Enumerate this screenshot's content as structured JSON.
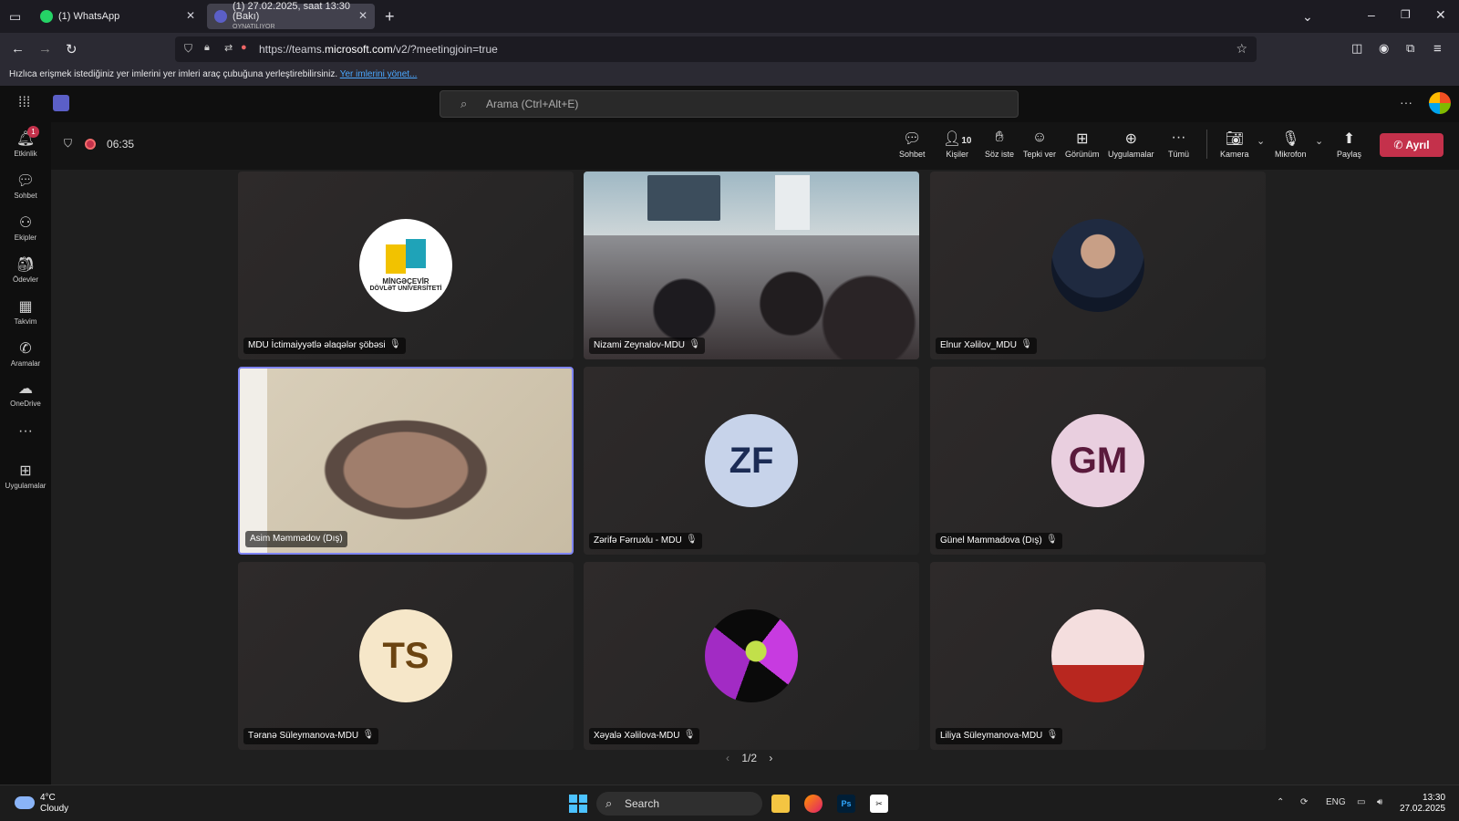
{
  "browser": {
    "tabs": [
      {
        "label": "(1) WhatsApp",
        "close": "✕"
      },
      {
        "label": "(1) 27.02.2025, saat 13:30 (Bakı)",
        "sublabel": "OYNATILIYOR",
        "close": "✕"
      }
    ],
    "new_tab": "+",
    "url_prefix": "https://teams.",
    "url_domain": "microsoft.com",
    "url_suffix": "/v2/?meetingjoin=true",
    "bookmarks_text": "Hızlıca erişmek istediğiniz yer imlerini yer imleri araç çubuğuna yerleştirebilirsiniz.",
    "bookmarks_link": "Yer imlerini yönet..."
  },
  "teams": {
    "search_placeholder": "Arama (Ctrl+Alt+E)"
  },
  "rail": [
    {
      "label": "Etkinlik",
      "badge": "1"
    },
    {
      "label": "Sohbet"
    },
    {
      "label": "Ekipler"
    },
    {
      "label": "Ödevler"
    },
    {
      "label": "Takvim"
    },
    {
      "label": "Aramalar"
    },
    {
      "label": "OneDrive"
    },
    {
      "label": "···"
    },
    {
      "label": "Uygulamalar"
    }
  ],
  "meeting": {
    "timer": "06:35",
    "controls": [
      {
        "label": "Sohbet"
      },
      {
        "label": "Kişiler",
        "count": "10"
      },
      {
        "label": "Söz iste"
      },
      {
        "label": "Tepki ver"
      },
      {
        "label": "Görünüm"
      },
      {
        "label": "Uygulamalar"
      },
      {
        "label": "Tümü"
      },
      {
        "label": "Kamera"
      },
      {
        "label": "Mikrofon"
      },
      {
        "label": "Paylaş"
      }
    ],
    "leave_label": "Ayrıl",
    "pager": "1/2",
    "participants": [
      {
        "name": "MDU İctimaiyyətlə əlaqələr şöbəsi",
        "logo_text_1": "MİNGƏÇEVİR",
        "logo_text_2": "DÖVLƏT UNİVERSİTETİ"
      },
      {
        "name": "Nizami Zeynalov-MDU"
      },
      {
        "name": "Elnur Xəlilov_MDU"
      },
      {
        "name": "Asim Məmmədov (Dış)"
      },
      {
        "name": "Zərifə Fərruxlu - MDU",
        "initials": "ZF"
      },
      {
        "name": "Günel Mammadova (Dış)",
        "initials": "GM"
      },
      {
        "name": "Təranə Süleymanova-MDU",
        "initials": "TS"
      },
      {
        "name": "Xəyalə Xəlilova-MDU"
      },
      {
        "name": "Liliya Süleymanova-MDU"
      }
    ]
  },
  "taskbar": {
    "temperature": "4°C",
    "weather": "Cloudy",
    "search": "Search",
    "lang": "ENG",
    "time": "13:30",
    "date": "27.02.2025"
  }
}
